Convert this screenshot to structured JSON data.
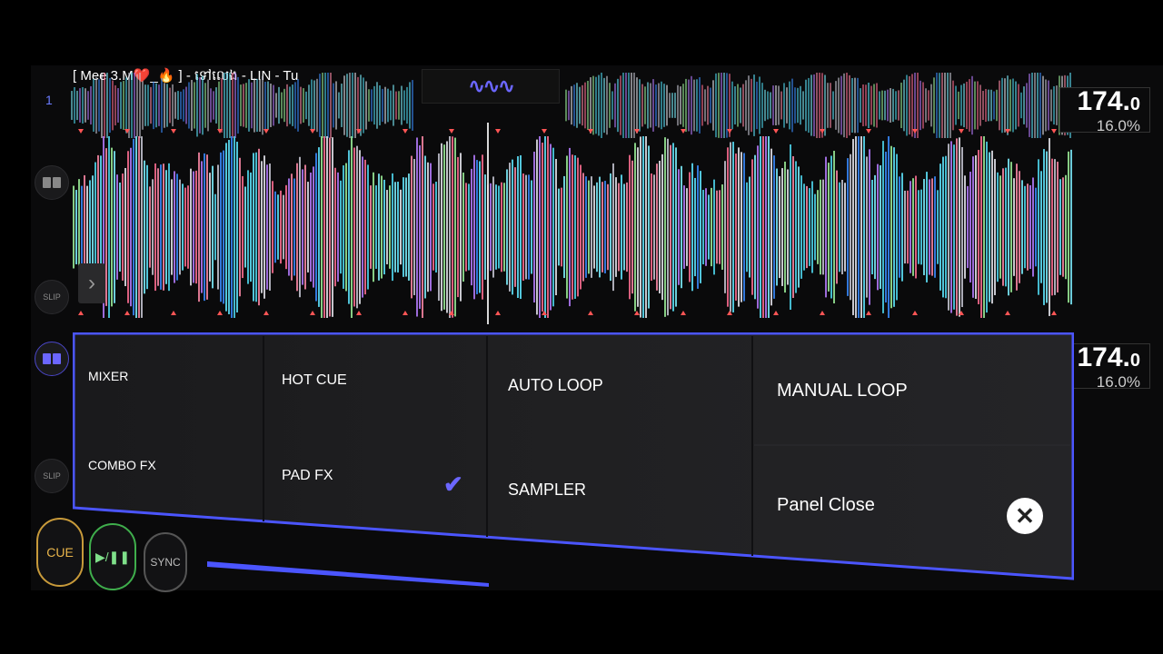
{
  "deck1": {
    "number": "1",
    "track_title": "[ Mee 3.M❤️_🔥 ] - ទៅលេង - LIN - Tu",
    "bpm_int": "174.",
    "bpm_dec": "0",
    "pitch": "16.0%"
  },
  "deck2": {
    "bpm_int": "174.",
    "bpm_dec": "0",
    "pitch": "16.0%"
  },
  "side": {
    "slip_label_1": "SLIP",
    "slip_label_2": "SLIP"
  },
  "panel": {
    "items": [
      {
        "label": "MIXER"
      },
      {
        "label": "COMBO FX"
      },
      {
        "label": "HOT CUE"
      },
      {
        "label": "PAD FX"
      },
      {
        "label": "AUTO LOOP"
      },
      {
        "label": "SAMPLER"
      },
      {
        "label": "MANUAL LOOP"
      },
      {
        "label": "Panel Close"
      }
    ],
    "selected": "PAD FX",
    "accent_color": "#4b55ff"
  },
  "transport": {
    "cue_label": "CUE",
    "play_label": "▶/❚❚",
    "sync_label": "SYNC"
  },
  "icons": {
    "waveform_view": "waveform-icon",
    "check": "check-icon",
    "close": "close-icon",
    "expand": "chevron-right-icon"
  }
}
